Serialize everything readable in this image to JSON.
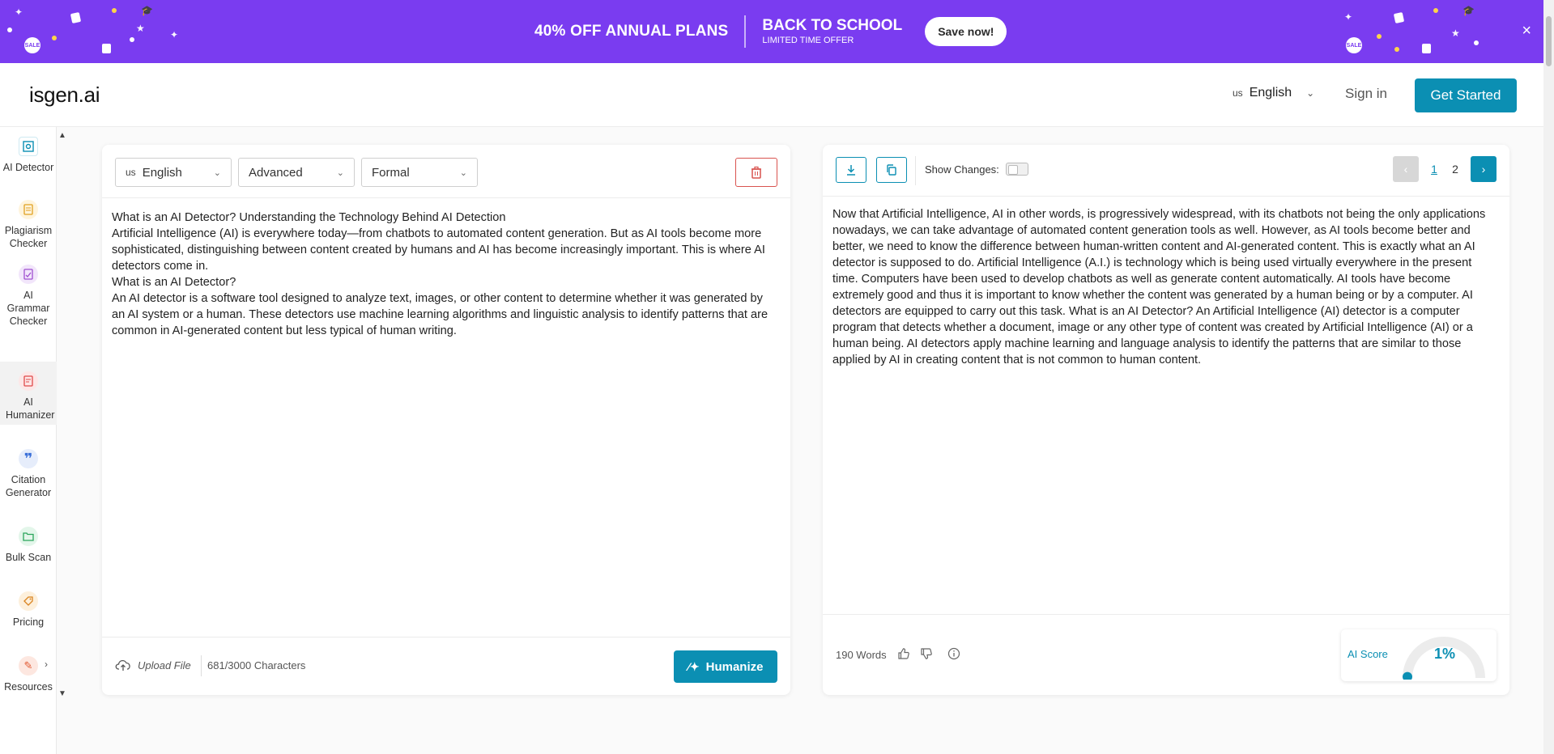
{
  "banner": {
    "offer": "40% OFF ANNUAL PLANS",
    "school_title": "BACK TO SCHOOL",
    "school_sub": "LIMITED TIME OFFER",
    "save_label": "Save now!",
    "close_icon": "×",
    "sale_badge": "SALE",
    "bg_color": "#7a3cf0"
  },
  "header": {
    "logo": "isgen.ai",
    "lang_flag": "us",
    "lang": "English",
    "signin": "Sign in",
    "get_started": "Get Started",
    "accent": "#0b8fb3"
  },
  "sidebar": {
    "items": [
      {
        "label": "AI Detector",
        "icon": "detector-icon"
      },
      {
        "label": "Plagiarism Checker",
        "icon": "plagiarism-icon"
      },
      {
        "label": "AI Grammar Checker",
        "icon": "grammar-icon"
      },
      {
        "label": "AI Humanizer",
        "icon": "humanizer-icon"
      },
      {
        "label": "Citation Generator",
        "icon": "citation-icon"
      },
      {
        "label": "Bulk Scan",
        "icon": "folder-icon"
      },
      {
        "label": "Pricing",
        "icon": "tag-icon"
      },
      {
        "label": "Resources",
        "icon": "resources-icon"
      }
    ]
  },
  "editor": {
    "lang_flag": "us",
    "lang": "English",
    "mode": "Advanced",
    "tone": "Formal",
    "lines": [
      "What is an AI Detector? Understanding the Technology Behind AI Detection",
      "Artificial Intelligence (AI) is everywhere today—from chatbots to automated content generation. But as AI tools become more sophisticated, distinguishing between content created by humans and AI has become increasingly important. This is where AI detectors come in.",
      "What is an AI Detector?",
      "An AI detector is a software tool designed to analyze text, images, or other content to determine whether it was generated by an AI system or a human. These detectors use machine learning algorithms and linguistic analysis to identify patterns that are common in AI-generated content but less typical of human writing."
    ],
    "upload_label": "Upload File",
    "char_count": "681/3000 Characters",
    "humanize_label": "Humanize"
  },
  "output": {
    "show_changes_label": "Show Changes:",
    "pages": [
      "1",
      "2"
    ],
    "current_page": "1",
    "text": "Now that Artificial Intelligence, AI in other words, is progressively widespread, with its chatbots not being the only applications nowadays, we can take advantage of automated content generation tools as well. However, as AI tools become better and better, we need to know the difference between human-written content and AI-generated content. This is exactly what an AI detector is supposed to do. Artificial Intelligence (A.I.) is technology which is being used virtually everywhere in the present time. Computers have been used to develop chatbots as well as generate content automatically. AI tools have become extremely good and thus it is important to know whether the content was generated by a human being or by a computer. AI detectors are equipped to carry out this task. What is an AI Detector? An Artificial Intelligence (AI) detector is a computer program that detects whether a document, image or any other type of content was created by Artificial Intelligence (AI) or a human being. AI detectors apply machine learning and language analysis to identify the patterns that are similar to those applied by AI in creating content that is not common to human content.",
    "word_count": "190 Words",
    "ai_score_label": "AI Score",
    "ai_score_value": "1%",
    "ai_score_fraction": 0.01
  }
}
